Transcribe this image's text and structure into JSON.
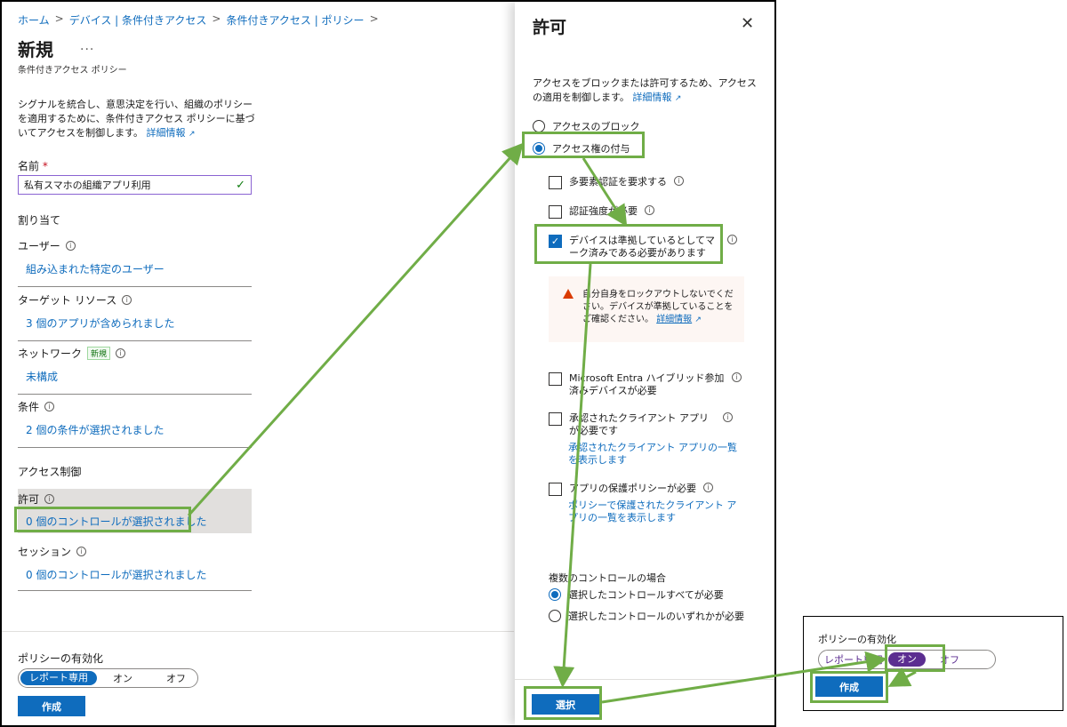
{
  "breadcrumb": [
    "ホーム",
    "デバイス | 条件付きアクセス",
    "条件付きアクセス | ポリシー"
  ],
  "left": {
    "title": "新規",
    "more": "...",
    "subtitle": "条件付きアクセス ポリシー",
    "intro": "シグナルを統合し、意思決定を行い、組織のポリシーを適用するために、条件付きアクセス ポリシーに基づいてアクセスを制御します。",
    "intro_link": "詳細情報",
    "name_label": "名前",
    "name_required": "*",
    "name_value": "私有スマホの組織アプリ利用",
    "assign_heading": "割り当て",
    "users_label": "ユーザー",
    "users_value": "組み込まれた特定のユーザー",
    "target_label": "ターゲット リソース",
    "target_value": "3 個のアプリが含められました",
    "network_label": "ネットワーク",
    "network_badge": "新規",
    "network_value": "未構成",
    "conditions_label": "条件",
    "conditions_value": "2 個の条件が選択されました",
    "access_heading": "アクセス制御",
    "grant_label": "許可",
    "grant_value": "0 個のコントロールが選択されました",
    "session_label": "セッション",
    "session_value": "0 個のコントロールが選択されました",
    "policy_label": "ポリシーの有効化",
    "toggle": [
      "レポート専用",
      "オン",
      "オフ"
    ],
    "create": "作成"
  },
  "panel": {
    "title": "許可",
    "close": "✕",
    "desc": "アクセスをブロックまたは許可するため、アクセスの適用を制御します。",
    "desc_link": "詳細情報",
    "block": "アクセスのブロック",
    "grant": "アクセス権の付与",
    "mfa": "多要素認証を要求する",
    "auth_strength": "認証強度が必要",
    "compliant": "デバイスは準拠しているとしてマーク済みである必要があります",
    "warning": "自分自身をロックアウトしないでください。デバイスが準拠していることをご確認ください。",
    "warning_link": "詳細情報",
    "hybrid": "Microsoft Entra ハイブリッド参加済みデバイスが必要",
    "approved_app": "承認されたクライアント アプリが必要です",
    "approved_link": "承認されたクライアント アプリの一覧を表示します",
    "app_protection": "アプリの保護ポリシーが必要",
    "app_protection_link": "ポリシーで保護されたクライアント アプリの一覧を表示します",
    "multi_label": "複数のコントロールの場合",
    "require_all": "選択したコントロールすべてが必要",
    "require_one": "選択したコントロールのいずれかが必要",
    "select": "選択"
  },
  "popup": {
    "label": "ポリシーの有効化",
    "toggle": [
      "レポート専用",
      "オン",
      "オフ"
    ],
    "create": "作成"
  },
  "colors": {
    "accent": "#0f6cbd",
    "highlight": "#70ad47",
    "purple": "#5c2e91"
  }
}
